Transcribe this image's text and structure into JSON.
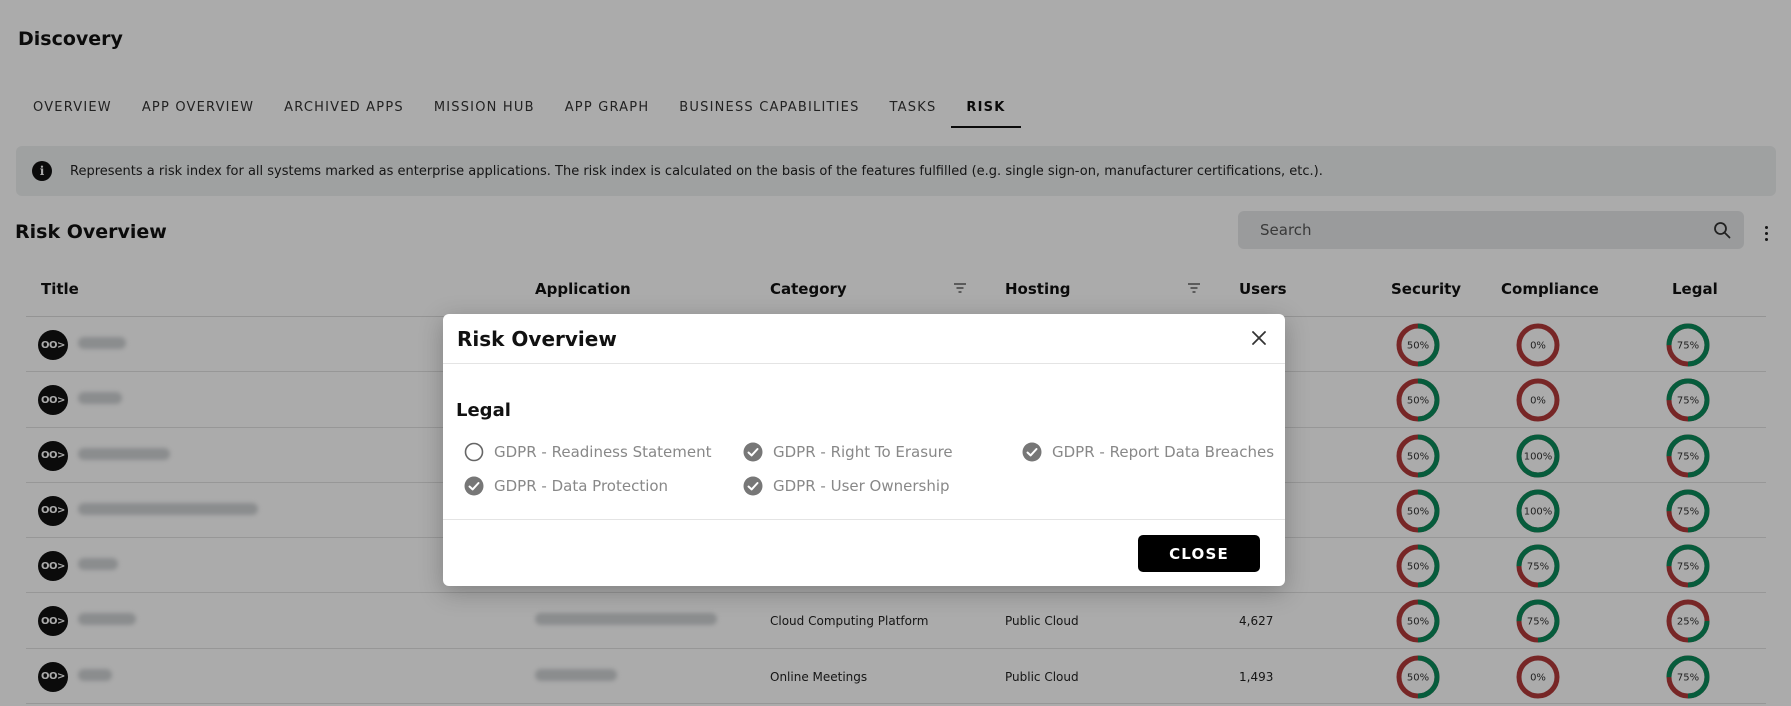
{
  "app": {
    "title": "Discovery"
  },
  "tabs": [
    {
      "label": "OVERVIEW"
    },
    {
      "label": "APP OVERVIEW"
    },
    {
      "label": "ARCHIVED APPS"
    },
    {
      "label": "MISSION HUB"
    },
    {
      "label": "APP GRAPH"
    },
    {
      "label": "BUSINESS CAPABILITIES"
    },
    {
      "label": "TASKS"
    },
    {
      "label": "RISK"
    }
  ],
  "active_tab": "RISK",
  "info": {
    "icon": "info-icon",
    "text": "Represents a risk index for all systems marked as enterprise applications. The risk index is calculated on the basis of the features fulfilled (e.g. single sign-on, manufacturer certifications, etc.)."
  },
  "section": {
    "title": "Risk Overview"
  },
  "search": {
    "placeholder": "Search"
  },
  "table": {
    "headers": {
      "title": "Title",
      "application": "Application",
      "category": "Category",
      "hosting": "Hosting",
      "users": "Users",
      "security": "Security",
      "compliance": "Compliance",
      "legal": "Legal"
    },
    "rows": [
      {
        "avatar": "OO>",
        "category": "",
        "hosting": "",
        "users": "",
        "security": 50,
        "compliance": 0,
        "legal": 75
      },
      {
        "avatar": "OO>",
        "category": "",
        "hosting": "",
        "users": "",
        "security": 50,
        "compliance": 0,
        "legal": 75
      },
      {
        "avatar": "OO>",
        "category": "",
        "hosting": "",
        "users": "",
        "security": 50,
        "compliance": 100,
        "legal": 75
      },
      {
        "avatar": "OO>",
        "category": "",
        "hosting": "",
        "users": "",
        "security": 50,
        "compliance": 100,
        "legal": 75
      },
      {
        "avatar": "OO>",
        "category": "",
        "hosting": "",
        "users": "",
        "security": 50,
        "compliance": 75,
        "legal": 75
      },
      {
        "avatar": "OO>",
        "category": "Cloud Computing Platform",
        "hosting": "Public Cloud",
        "users": "4,627",
        "security": 50,
        "compliance": 75,
        "legal": 25
      },
      {
        "avatar": "OO>",
        "category": "Online Meetings",
        "hosting": "Public Cloud",
        "users": "1,493",
        "security": 50,
        "compliance": 0,
        "legal": 75
      }
    ]
  },
  "colors": {
    "donut_good": "#0a8a5a",
    "donut_bad": "#b23a3a"
  },
  "modal": {
    "title": "Risk Overview",
    "section": "Legal",
    "items": [
      {
        "label": "GDPR - Readiness Statement",
        "checked": false
      },
      {
        "label": "GDPR - Right To Erasure",
        "checked": true
      },
      {
        "label": "GDPR - Report Data Breaches",
        "checked": true
      },
      {
        "label": "GDPR - Data Protection",
        "checked": true
      },
      {
        "label": "GDPR - User Ownership",
        "checked": true
      }
    ],
    "close_label": "CLOSE"
  }
}
